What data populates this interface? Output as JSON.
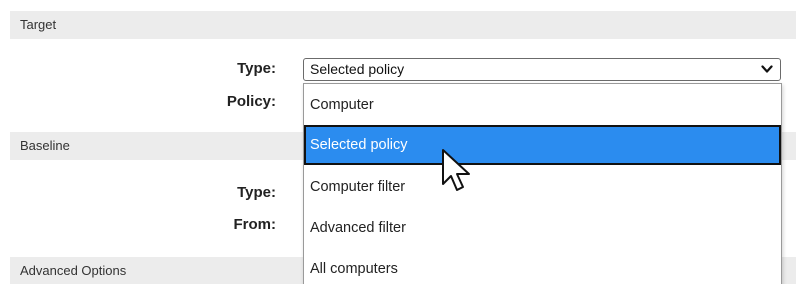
{
  "sections": {
    "target": "Target",
    "baseline": "Baseline",
    "advanced": "Advanced Options"
  },
  "target": {
    "type_label": "Type:",
    "policy_label": "Policy:",
    "type_value": "Selected policy"
  },
  "baseline": {
    "type_label": "Type:",
    "from_label": "From:"
  },
  "dropdown": {
    "options": [
      {
        "label": "Computer",
        "selected": false
      },
      {
        "label": "Selected policy",
        "selected": true
      },
      {
        "label": "Computer filter",
        "selected": false
      },
      {
        "label": "Advanced filter",
        "selected": false
      },
      {
        "label": "All computers",
        "selected": false
      }
    ]
  },
  "icons": {
    "select_chevron": "chevron-down-icon",
    "cursor": "mouse-cursor-icon"
  },
  "colors": {
    "selected_option_bg": "#2b8cef",
    "section_header_bg": "#ececec"
  }
}
